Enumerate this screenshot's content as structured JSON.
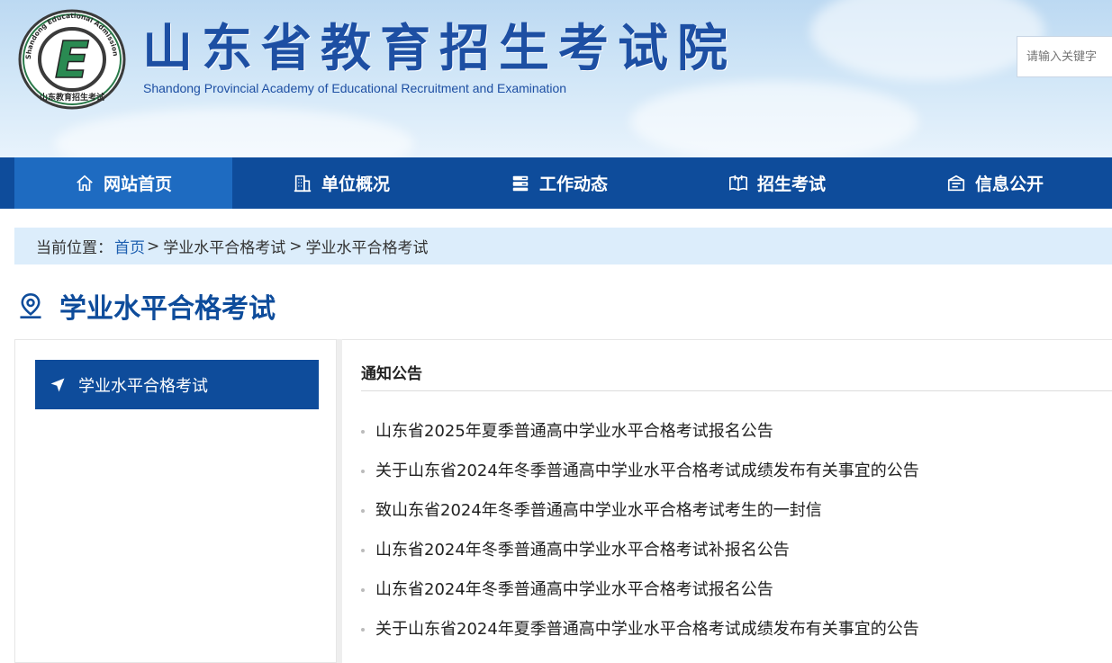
{
  "header": {
    "title_cn": "山东省教育招生考试院",
    "title_en": "Shandong Provincial Academy of Educational Recruitment and Examination",
    "logo_ring_text": "Shandong Educational Admission & Examination",
    "logo_bottom_text": "山东教育招生考试",
    "logo_letter": "E"
  },
  "search": {
    "placeholder": "请输入关键字"
  },
  "nav": {
    "items": [
      {
        "label": "网站首页",
        "icon": "home-icon",
        "active": true
      },
      {
        "label": "单位概况",
        "icon": "building-icon"
      },
      {
        "label": "工作动态",
        "icon": "server-icon"
      },
      {
        "label": "招生考试",
        "icon": "book-icon"
      },
      {
        "label": "信息公开",
        "icon": "info-box-icon"
      }
    ]
  },
  "breadcrumb": {
    "prefix": "当前位置：",
    "home": "首页",
    "sep1": " > ",
    "level1": "学业水平合格考试",
    "sep2": " >",
    "level2": "学业水平合格考试"
  },
  "page": {
    "title": "学业水平合格考试",
    "icon": "location-pin-icon"
  },
  "sidebar": {
    "items": [
      {
        "label": "学业水平合格考试",
        "icon": "navigation-arrow-icon"
      }
    ]
  },
  "notices": {
    "heading": "通知公告",
    "items": [
      "山东省2025年夏季普通高中学业水平合格考试报名公告",
      "关于山东省2024年冬季普通高中学业水平合格考试成绩发布有关事宜的公告",
      "致山东省2024年冬季普通高中学业水平合格考试考生的一封信",
      "山东省2024年冬季普通高中学业水平合格考试补报名公告",
      "山东省2024年冬季普通高中学业水平合格考试报名公告",
      "关于山东省2024年夏季普通高中学业水平合格考试成绩发布有关事宜的公告"
    ]
  },
  "colors": {
    "primary": "#0e4c9b",
    "nav_active": "#1e6bc1",
    "crumb_bg": "#dcedfb",
    "title_blue": "#1d4fa3"
  }
}
